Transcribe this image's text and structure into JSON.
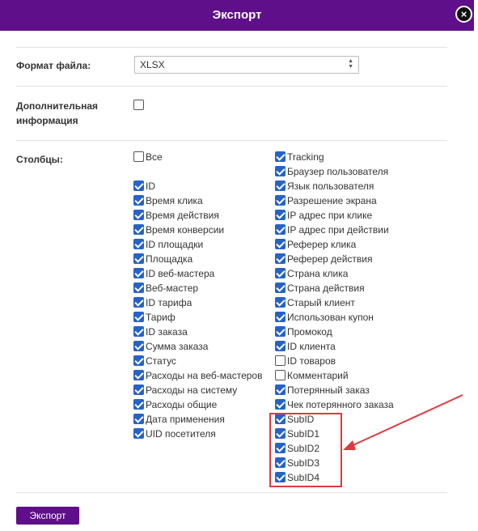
{
  "header": {
    "title": "Экспорт",
    "close_icon": "×"
  },
  "format": {
    "label": "Формат файла:",
    "value": "XLSX"
  },
  "extra": {
    "label_line1": "Дополнительная",
    "label_line2": "информация",
    "checked": false
  },
  "columns": {
    "label": "Столбцы:",
    "all": {
      "label": "Все",
      "checked": false
    },
    "left": [
      {
        "label": "ID",
        "checked": true
      },
      {
        "label": "Время клика",
        "checked": true
      },
      {
        "label": "Время действия",
        "checked": true
      },
      {
        "label": "Время конверсии",
        "checked": true
      },
      {
        "label": "ID площадки",
        "checked": true
      },
      {
        "label": "Площадка",
        "checked": true
      },
      {
        "label": "ID веб-мастера",
        "checked": true
      },
      {
        "label": "Веб-мастер",
        "checked": true
      },
      {
        "label": "ID тарифа",
        "checked": true
      },
      {
        "label": "Тариф",
        "checked": true
      },
      {
        "label": "ID заказа",
        "checked": true
      },
      {
        "label": "Сумма заказа",
        "checked": true
      },
      {
        "label": "Статус",
        "checked": true
      },
      {
        "label": "Расходы на веб-мастеров",
        "checked": true
      },
      {
        "label": "Расходы на систему",
        "checked": true
      },
      {
        "label": "Расходы общие",
        "checked": true
      },
      {
        "label": "Дата применения",
        "checked": true
      },
      {
        "label": "UID посетителя",
        "checked": true
      }
    ],
    "right": [
      {
        "label": "Tracking",
        "checked": true
      },
      {
        "label": "Браузер пользователя",
        "checked": true
      },
      {
        "label": "Язык пользователя",
        "checked": true
      },
      {
        "label": "Разрешение экрана",
        "checked": true
      },
      {
        "label": "IP адрес при клике",
        "checked": true
      },
      {
        "label": "IP адрес при действии",
        "checked": true
      },
      {
        "label": "Реферер клика",
        "checked": true
      },
      {
        "label": "Реферер действия",
        "checked": true
      },
      {
        "label": "Страна клика",
        "checked": true
      },
      {
        "label": "Страна действия",
        "checked": true
      },
      {
        "label": "Старый клиент",
        "checked": true
      },
      {
        "label": "Использован купон",
        "checked": true
      },
      {
        "label": "Промокод",
        "checked": true
      },
      {
        "label": "ID клиента",
        "checked": true
      },
      {
        "label": "ID товаров",
        "checked": false
      },
      {
        "label": "Комментарий",
        "checked": false
      },
      {
        "label": "Потерянный заказ",
        "checked": true
      },
      {
        "label": "Чек потерянного заказа",
        "checked": true
      },
      {
        "label": "SubID",
        "checked": true
      },
      {
        "label": "SubID1",
        "checked": true
      },
      {
        "label": "SubID2",
        "checked": true
      },
      {
        "label": "SubID3",
        "checked": true
      },
      {
        "label": "SubID4",
        "checked": true
      }
    ]
  },
  "footer": {
    "export_label": "Экспорт"
  },
  "colors": {
    "header_bg": "#5f0f89",
    "checkbox": "#2763c6",
    "annotation": "#e0393e"
  }
}
